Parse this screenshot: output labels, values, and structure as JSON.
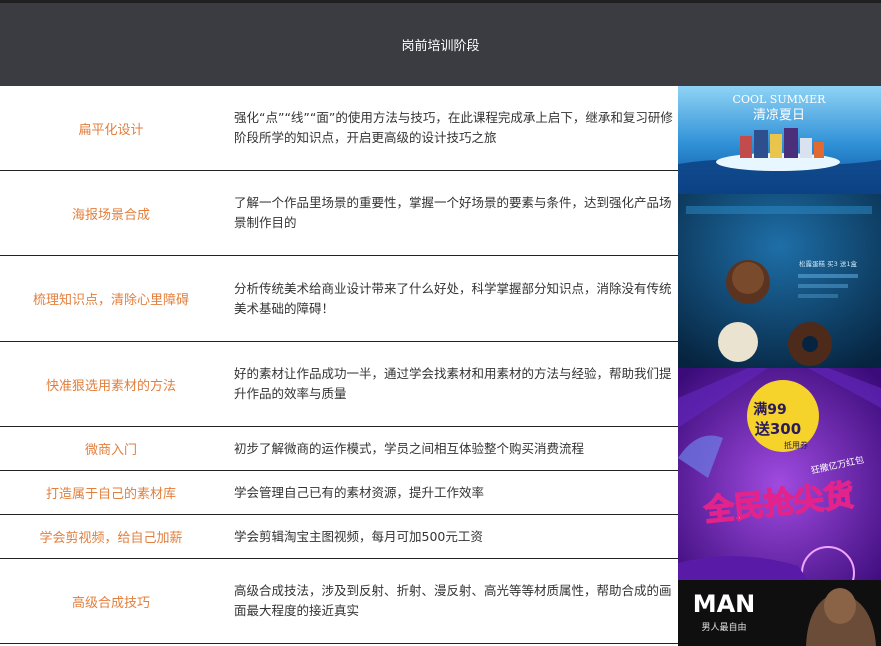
{
  "header": {
    "title": "岗前培训阶段"
  },
  "rows": [
    {
      "topic": "扁平化设计",
      "desc": "强化“点”“线”“面”的使用方法与技巧，在此课程完成承上启下，继承和复习研修阶段所学的知识点，开启更高级的设计技巧之旅"
    },
    {
      "topic": "海报场景合成",
      "desc": "了解一个作品里场景的重要性，掌握一个好场景的要素与条件，达到强化产品场景制作目的"
    },
    {
      "topic": "梳理知识点，清除心里障碍",
      "desc": "分析传统美术给商业设计带来了什么好处，科学掌握部分知识点，消除没有传统美术基础的障碍！"
    },
    {
      "topic": "快准狠选用素材的方法",
      "desc": "好的素材让作品成功一半，通过学会找素材和用素材的方法与经验，帮助我们提升作品的效率与质量"
    },
    {
      "topic": "微商入门",
      "desc": "初步了解微商的运作模式，学员之间相互体验整个购买消费流程"
    },
    {
      "topic": "打造属于自己的素材库",
      "desc": "学会管理自己已有的素材资源，提升工作效率"
    },
    {
      "topic": "学会剪视频，给自己加薪",
      "desc": "学会剪辑淘宝主图视频，每月可加500元工资"
    },
    {
      "topic": "高级合成技巧",
      "desc": "高级合成技法，涉及到反射、折射、漫反射、高光等等材质属性，帮助合成的画面最大程度的接近真实"
    }
  ],
  "banners": {
    "summer": {
      "en": "COOL SUMMER",
      "cn": "清凉夏日"
    },
    "dessert": {
      "caption": "松露蛋糕 买3 送1盒"
    },
    "sale": {
      "line1a": "满",
      "line1b": "99",
      "line2a": "送",
      "line2b": "300",
      "tag": "抵用券",
      "slogan": "狂撒亿万红包",
      "big": "全民抢尖货"
    },
    "man": {
      "title": "MAN",
      "sub": "男人最自由"
    }
  }
}
